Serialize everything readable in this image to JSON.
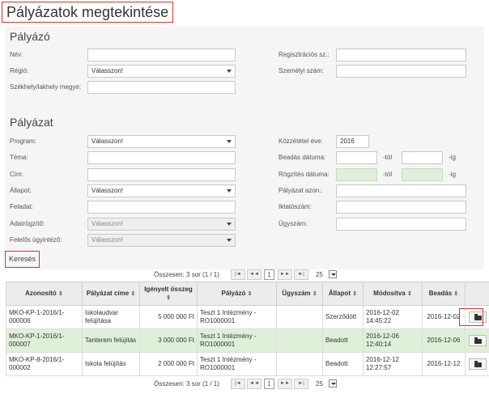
{
  "page": {
    "title": "Pályázatok megtekintése"
  },
  "applicant": {
    "section_title": "Pályázó",
    "name_label": "Név:",
    "region_label": "Régió:",
    "region_value": "Válasszon!",
    "seat_label": "Székhely/lakhely megye:",
    "regnum_label": "Regisztrációs sz.:",
    "personal_label": "Személyi szám:"
  },
  "application": {
    "section_title": "Pályázat",
    "program_label": "Program:",
    "program_value": "Válasszon!",
    "topic_label": "Téma:",
    "title_label": "Cím:",
    "status_label": "Állapot:",
    "status_value": "Válasszon!",
    "task_label": "Feladat:",
    "recorder_label": "Adatrögzítő:",
    "recorder_value": "Válasszon!",
    "officer_label": "Felelős ügyintéző:",
    "officer_value": "Válasszon!",
    "pubyear_label": "Közzététel éve:",
    "pubyear_value": "2016",
    "submit_label": "Beadás dátuma:",
    "record_label": "Rögzítés dátuma:",
    "from_label": "-tól",
    "to_label": "-ig",
    "appid_label": "Pályázat azon.:",
    "filing_label": "Iktatószám:",
    "caseno_label": "Ügyszám:"
  },
  "search": {
    "label": "Keresés"
  },
  "pager": {
    "summary": "Összesen: 3 sor (1 / 1)",
    "first": "|◄",
    "prev": "◄◄",
    "page": "1",
    "next": "►►",
    "last": "►|",
    "page_size": "25"
  },
  "table": {
    "headers": [
      "Azonosító",
      "Pályázat címe",
      "Igényelt összeg",
      "Pályázó",
      "Ügyszám",
      "Állapot",
      "Módosítva",
      "Beadás"
    ],
    "sort_icon": "⇕",
    "rows": [
      {
        "id": "MKO-KP-1-2016/1-000006",
        "title": "Iskolaudvar felújítása",
        "amount": "5 000 000 Ft",
        "applicant": "Teszt 1 Intézmény - RO1000001",
        "case": "",
        "status": "Szerződött",
        "modified": "2016-12-02 14:45:22",
        "submitted": "2016-12-02"
      },
      {
        "id": "MKO-KP-1-2016/1-000007",
        "title": "Tanterem felújítás",
        "amount": "3 000 000 Ft",
        "applicant": "Teszt 1 Intézmény - RO1000001",
        "case": "",
        "status": "Beadott",
        "modified": "2016-12-06 12:40:14",
        "submitted": "2016-12-06"
      },
      {
        "id": "MKO-KP-8-2016/1-000002",
        "title": "Iskola felújítás",
        "amount": "2 000 000 Ft",
        "applicant": "Teszt 1 Intézmény - RO1000001",
        "case": "",
        "status": "Beadott",
        "modified": "2016-12-12 12:27:57",
        "submitted": "2016-12-12"
      }
    ]
  }
}
